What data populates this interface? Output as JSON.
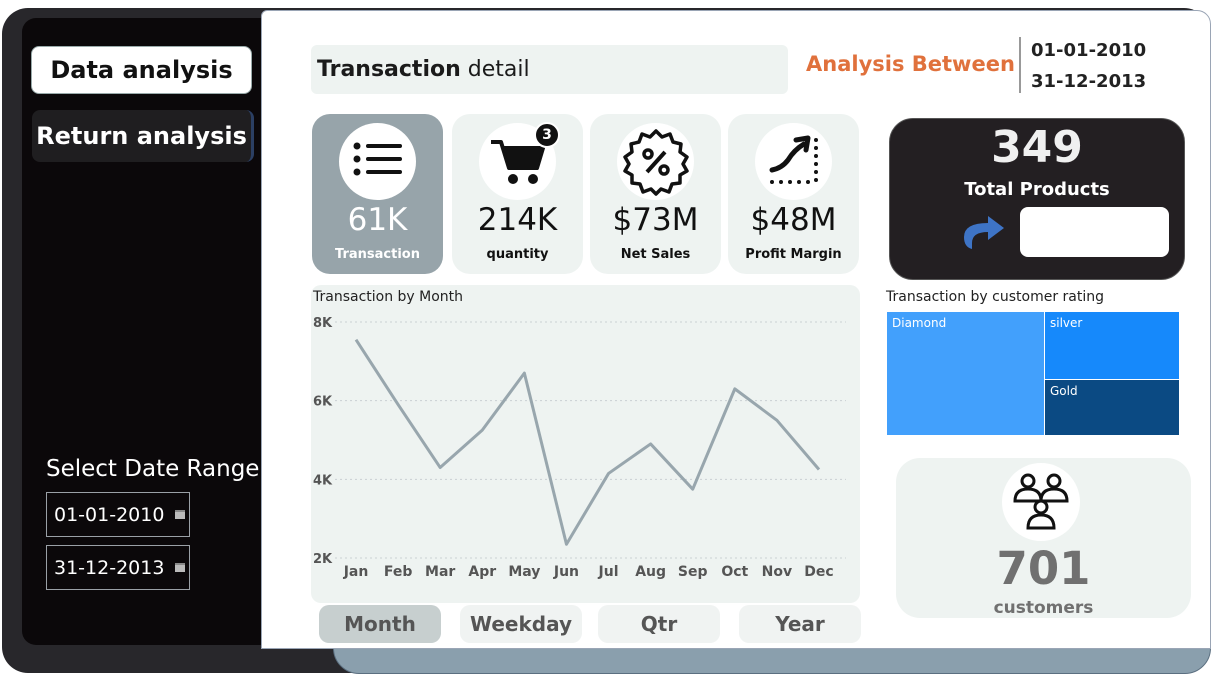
{
  "nav": {
    "data_analysis": "Data analysis",
    "return_analysis": "Return analysis"
  },
  "date_range": {
    "title": "Select Date Range",
    "start": "01-01-2010",
    "end": "31-12-2013"
  },
  "header": {
    "title_bold": "Transaction",
    "title_rest": "detail",
    "analysis_between": "Analysis Between",
    "start_date": "01-01-2010",
    "end_date": "31-12-2013"
  },
  "kpis": [
    {
      "value": "61K",
      "label": "Transaction",
      "icon": "list-icon"
    },
    {
      "value": "214K",
      "label": "quantity",
      "icon": "cart-icon",
      "badge": "3"
    },
    {
      "value": "$73M",
      "label": "Net Sales",
      "icon": "percent-badge-icon"
    },
    {
      "value": "$48M",
      "label": "Profit Margin",
      "icon": "trend-up-icon"
    }
  ],
  "total_products": {
    "value": "349",
    "label": "Total Products"
  },
  "chart": {
    "title": "Transaction by Month",
    "line_color": "#98a6ad"
  },
  "chart_data": {
    "type": "line",
    "categories": [
      "Jan",
      "Feb",
      "Mar",
      "Apr",
      "May",
      "Jun",
      "Jul",
      "Aug",
      "Sep",
      "Oct",
      "Nov",
      "Dec"
    ],
    "values": [
      7550,
      5900,
      4300,
      5250,
      6700,
      2350,
      4150,
      4900,
      3750,
      6300,
      5500,
      4250
    ],
    "ylim": [
      2000,
      8000
    ],
    "yticks": [
      "2K",
      "4K",
      "6K",
      "8K"
    ],
    "grid": true
  },
  "tabs": {
    "month": "Month",
    "weekday": "Weekday",
    "qtr": "Qtr",
    "year": "Year"
  },
  "treemap": {
    "title": "Transaction by customer rating",
    "items": [
      {
        "label": "Diamond",
        "color": "#42a0fc"
      },
      {
        "label": "silver",
        "color": "#1689fb"
      },
      {
        "label": "Gold",
        "color": "#0b4a83"
      }
    ]
  },
  "customers": {
    "value": "701",
    "label": "customers"
  }
}
